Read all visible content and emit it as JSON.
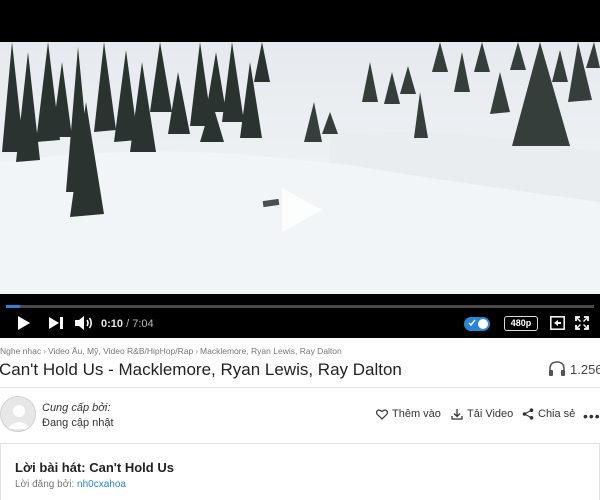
{
  "player": {
    "current_time": "0:10",
    "separator": " / ",
    "duration": "7:04",
    "progress_fraction": 0.024,
    "autoplay_on": true,
    "quality": "480p",
    "accent_color": "#2a85d9"
  },
  "breadcrumb": [
    "Nghe nhạc",
    "Video Âu, Mỹ, Video R&B/HipHop/Rap",
    "Macklemore, Ryan Lewis, Ray Dalton"
  ],
  "song": {
    "title": "Can't Hold Us - Macklemore, Ryan Lewis, Ray Dalton",
    "listen_count": "1.256"
  },
  "provider": {
    "label": "Cung cấp bởi:",
    "value": "Đang cập nhật"
  },
  "actions": {
    "add_label": "Thêm vào",
    "download_label": "Tải Video",
    "share_label": "Chia sẻ",
    "more_label": "•••"
  },
  "lyrics": {
    "title": "Lời bài hát: Can't Hold Us",
    "author_prefix": "Lời đăng bởi:",
    "author_name": "nh0cxahoa"
  },
  "icons": [
    "play-icon",
    "next-icon",
    "volume-icon",
    "captions-icon",
    "fullscreen-icon",
    "headphones-icon",
    "heart-icon",
    "download-icon",
    "share-icon",
    "user-avatar-icon"
  ]
}
